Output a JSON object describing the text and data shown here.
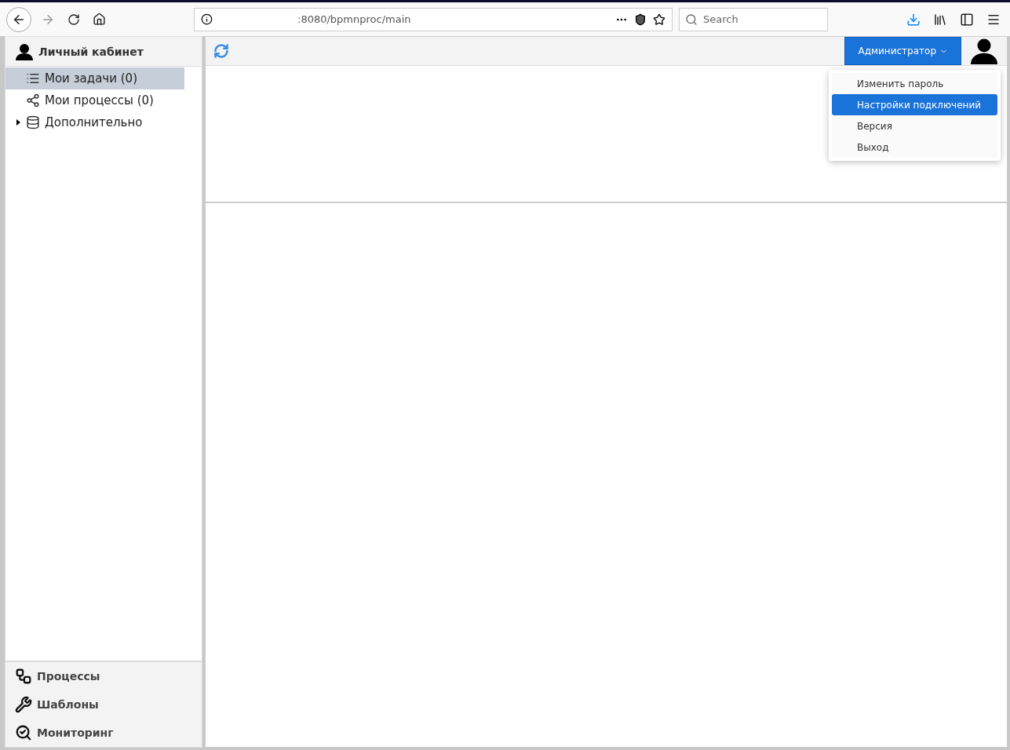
{
  "browser": {
    "url": ":8080/bpmnproc/main",
    "search_placeholder": "Search"
  },
  "sidebar": {
    "title": "Личный кабинет",
    "items": [
      {
        "kind": "list",
        "label": "Мои задачи (0)",
        "selected": true
      },
      {
        "kind": "share",
        "label": "Мои процессы (0)",
        "selected": false
      },
      {
        "kind": "database",
        "label": "Дополнительно",
        "selected": false,
        "expanded": false
      }
    ],
    "sections": [
      {
        "kind": "processes",
        "label": "Процессы"
      },
      {
        "kind": "templates",
        "label": "Шаблоны"
      },
      {
        "kind": "monitoring",
        "label": "Мониторинг"
      }
    ]
  },
  "topbar": {
    "user": "Администратор"
  },
  "user_menu": [
    {
      "label": "Изменить пароль",
      "selected": false
    },
    {
      "label": "Настройки подключений",
      "selected": true
    },
    {
      "label": "Версия",
      "selected": false
    },
    {
      "label": "Выход",
      "selected": false
    }
  ]
}
